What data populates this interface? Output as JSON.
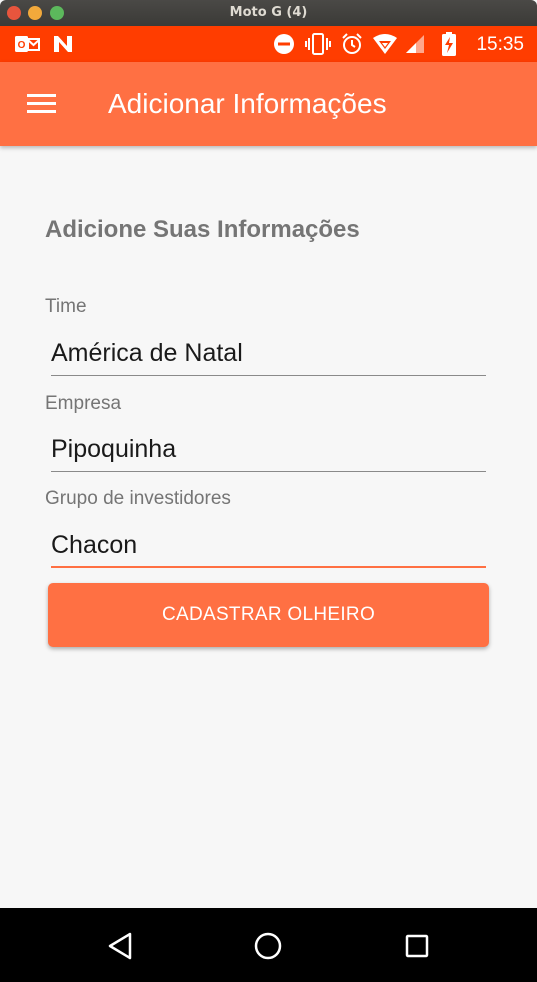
{
  "window": {
    "title": "Moto G (4)"
  },
  "status_bar": {
    "time": "15:35",
    "icons": [
      "outlook-icon",
      "n-app-icon",
      "do-not-disturb-icon",
      "vibrate-icon",
      "alarm-icon",
      "wifi-icon",
      "signal-icon",
      "battery-charging-icon"
    ]
  },
  "app_bar": {
    "title": "Adicionar Informações",
    "menu_icon": "hamburger-menu-icon"
  },
  "form": {
    "heading": "Adicione Suas Informações",
    "fields": [
      {
        "label": "Time",
        "value": "América de Natal"
      },
      {
        "label": "Empresa",
        "value": "Pipoquinha"
      },
      {
        "label": "Grupo de investidores",
        "value": "Chacon"
      }
    ],
    "submit_label": "CADASTRAR OLHEIRO"
  },
  "nav_bar": {
    "icons": [
      "back-icon",
      "home-icon",
      "recents-icon"
    ]
  },
  "colors": {
    "accent": "#ff7043",
    "status_bar": "#ff3d00",
    "label": "#757575"
  }
}
